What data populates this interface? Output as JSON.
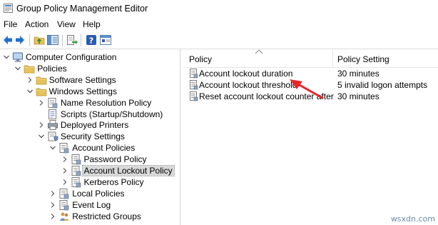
{
  "window": {
    "title": "Group Policy Management Editor"
  },
  "menu": [
    "File",
    "Action",
    "View",
    "Help"
  ],
  "toolbar": {
    "buttons": [
      "back-arrow-icon",
      "forward-arrow-icon",
      "up-folder-icon",
      "show-hide-tree-icon",
      "export-list-icon",
      "help-icon",
      "properties-icon"
    ]
  },
  "tree": {
    "items": [
      {
        "label": "Computer Configuration",
        "icon": "computer-icon",
        "expanded": true
      },
      {
        "label": "Policies",
        "icon": "folder-icon",
        "expanded": true
      },
      {
        "label": "Software Settings",
        "icon": "folder-icon",
        "expanded": false
      },
      {
        "label": "Windows Settings",
        "icon": "folder-icon",
        "expanded": true
      },
      {
        "label": "Name Resolution Policy",
        "icon": "policy-icon",
        "expanded": false
      },
      {
        "label": "Scripts (Startup/Shutdown)",
        "icon": "script-icon",
        "expanded": null
      },
      {
        "label": "Deployed Printers",
        "icon": "printer-icon",
        "expanded": false
      },
      {
        "label": "Security Settings",
        "icon": "security-icon",
        "expanded": true
      },
      {
        "label": "Account Policies",
        "icon": "policy-icon",
        "expanded": true
      },
      {
        "label": "Password Policy",
        "icon": "policy-icon",
        "expanded": false
      },
      {
        "label": "Account Lockout Policy",
        "icon": "policy-icon",
        "expanded": false,
        "selected": true
      },
      {
        "label": "Kerberos Policy",
        "icon": "policy-icon",
        "expanded": false
      },
      {
        "label": "Local Policies",
        "icon": "policy-icon",
        "expanded": false
      },
      {
        "label": "Event Log",
        "icon": "policy-icon",
        "expanded": false
      },
      {
        "label": "Restricted Groups",
        "icon": "restricted-groups-icon",
        "expanded": false
      }
    ]
  },
  "list": {
    "columns": [
      "Policy",
      "Policy Setting"
    ],
    "rows": [
      {
        "policy": "Account lockout duration",
        "setting": "30 minutes"
      },
      {
        "policy": "Account lockout threshold",
        "setting": "5 invalid logon attempts"
      },
      {
        "policy": "Reset account lockout counter after",
        "setting": "30 minutes"
      }
    ]
  },
  "annotation": {
    "arrow_color": "#e8262a"
  },
  "colors": {
    "selection": "#d9d9d9",
    "folder": "#e8c25a"
  },
  "watermark": "wsxdn.com"
}
